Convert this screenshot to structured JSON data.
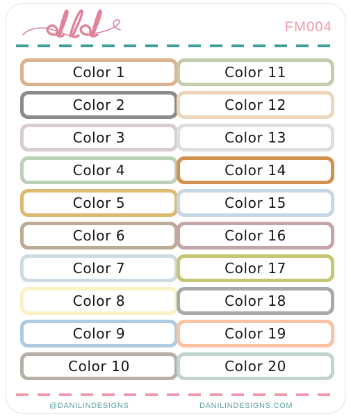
{
  "header": {
    "logo_text": "dld",
    "logo_color": "#e08298",
    "sku": "FM004",
    "sku_color": "#ef9aaa",
    "divider_color": "#3f9d9a"
  },
  "footer": {
    "handle": "@DANILINDESIGNS",
    "website": "DANILINDESIGNS.COM",
    "text_color": "#5fa0a0",
    "divider_color": "#ef9aaa"
  },
  "labels": {
    "left_column": [
      {
        "text": "Color 1",
        "color": "#dcb18e"
      },
      {
        "text": "Color 2",
        "color": "#8b8b8b"
      },
      {
        "text": "Color 3",
        "color": "#d9ccd5"
      },
      {
        "text": "Color 4",
        "color": "#bcd0ba"
      },
      {
        "text": "Color 5",
        "color": "#ddba72"
      },
      {
        "text": "Color 6",
        "color": "#bcab96"
      },
      {
        "text": "Color 7",
        "color": "#ccdce2"
      },
      {
        "text": "Color 8",
        "color": "#faf2c4"
      },
      {
        "text": "Color 9",
        "color": "#aecbe2"
      },
      {
        "text": "Color 10",
        "color": "#b6afa6"
      }
    ],
    "right_column": [
      {
        "text": "Color 11",
        "color": "#c2cdad"
      },
      {
        "text": "Color 12",
        "color": "#eed5bc"
      },
      {
        "text": "Color 13",
        "color": "#dededf"
      },
      {
        "text": "Color 14",
        "color": "#d2914f"
      },
      {
        "text": "Color 15",
        "color": "#c6d7e6"
      },
      {
        "text": "Color 16",
        "color": "#c6a5a8"
      },
      {
        "text": "Color 17",
        "color": "#c6c772"
      },
      {
        "text": "Color 18",
        "color": "#a9a9a9"
      },
      {
        "text": "Color 19",
        "color": "#fbc2a4"
      },
      {
        "text": "Color 20",
        "color": "#c2d4cf"
      }
    ]
  }
}
